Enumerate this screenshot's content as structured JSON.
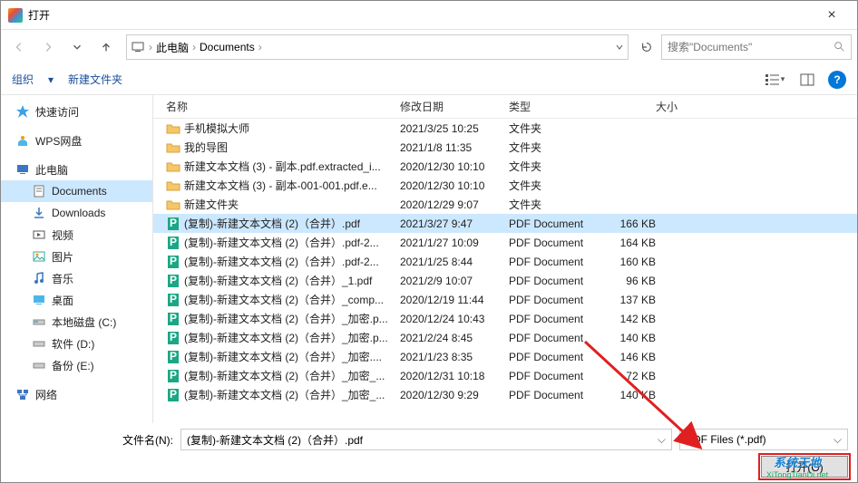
{
  "title": "打开",
  "breadcrumb": {
    "pc": "此电脑",
    "folder": "Documents"
  },
  "search_placeholder": "搜索\"Documents\"",
  "toolbar": {
    "organize": "组织",
    "newfolder": "新建文件夹"
  },
  "sidebar": {
    "quick": "快速访问",
    "wps": "WPS网盘",
    "pc": "此电脑",
    "documents": "Documents",
    "downloads": "Downloads",
    "videos": "视频",
    "pictures": "图片",
    "music": "音乐",
    "desktop": "桌面",
    "diskc": "本地磁盘 (C:)",
    "diskd": "软件 (D:)",
    "diske": "备份 (E:)",
    "network": "网络"
  },
  "columns": {
    "name": "名称",
    "date": "修改日期",
    "type": "类型",
    "size": "大小"
  },
  "folder_type": "文件夹",
  "pdf_type": "PDF Document",
  "files": [
    {
      "icon": "folder",
      "name": "手机模拟大师",
      "date": "2021/3/25 10:25",
      "type": "文件夹",
      "size": ""
    },
    {
      "icon": "folder",
      "name": "我的导图",
      "date": "2021/1/8 11:35",
      "type": "文件夹",
      "size": ""
    },
    {
      "icon": "folder",
      "name": "新建文本文档 (3) - 副本.pdf.extracted_i...",
      "date": "2020/12/30 10:10",
      "type": "文件夹",
      "size": ""
    },
    {
      "icon": "folder",
      "name": "新建文本文档 (3) - 副本-001-001.pdf.e...",
      "date": "2020/12/30 10:10",
      "type": "文件夹",
      "size": ""
    },
    {
      "icon": "folder",
      "name": "新建文件夹",
      "date": "2020/12/29 9:07",
      "type": "文件夹",
      "size": ""
    },
    {
      "icon": "pdf",
      "name": "(复制)-新建文本文档 (2)（合并）.pdf",
      "date": "2021/3/27 9:47",
      "type": "PDF Document",
      "size": "166 KB",
      "selected": true
    },
    {
      "icon": "pdf",
      "name": "(复制)-新建文本文档 (2)（合并）.pdf-2...",
      "date": "2021/1/27 10:09",
      "type": "PDF Document",
      "size": "164 KB"
    },
    {
      "icon": "pdf",
      "name": "(复制)-新建文本文档 (2)（合并）.pdf-2...",
      "date": "2021/1/25 8:44",
      "type": "PDF Document",
      "size": "160 KB"
    },
    {
      "icon": "pdf",
      "name": "(复制)-新建文本文档 (2)（合并）_1.pdf",
      "date": "2021/2/9 10:07",
      "type": "PDF Document",
      "size": "96 KB"
    },
    {
      "icon": "pdf",
      "name": "(复制)-新建文本文档 (2)（合并）_comp...",
      "date": "2020/12/19 11:44",
      "type": "PDF Document",
      "size": "137 KB"
    },
    {
      "icon": "pdf",
      "name": "(复制)-新建文本文档 (2)（合并）_加密.p...",
      "date": "2020/12/24 10:43",
      "type": "PDF Document",
      "size": "142 KB"
    },
    {
      "icon": "pdf",
      "name": "(复制)-新建文本文档 (2)（合并）_加密.p...",
      "date": "2021/2/24 8:45",
      "type": "PDF Document",
      "size": "140 KB"
    },
    {
      "icon": "pdf",
      "name": "(复制)-新建文本文档 (2)（合并）_加密....",
      "date": "2021/1/23 8:35",
      "type": "PDF Document",
      "size": "146 KB"
    },
    {
      "icon": "pdf",
      "name": "(复制)-新建文本文档 (2)（合并）_加密_...",
      "date": "2020/12/31 10:18",
      "type": "PDF Document",
      "size": "72 KB"
    },
    {
      "icon": "pdf",
      "name": "(复制)-新建文本文档 (2)（合并）_加密_...",
      "date": "2020/12/30 9:29",
      "type": "PDF Document",
      "size": "140 KB"
    }
  ],
  "filename_label": "文件名(N):",
  "filename_value": "(复制)-新建文本文档 (2)（合并）.pdf",
  "filter_value": "PDF Files (*.pdf)",
  "open_btn": "打开(O)",
  "watermark": {
    "line1": "系统天地",
    "line2": "XiTongTianDi.net"
  }
}
